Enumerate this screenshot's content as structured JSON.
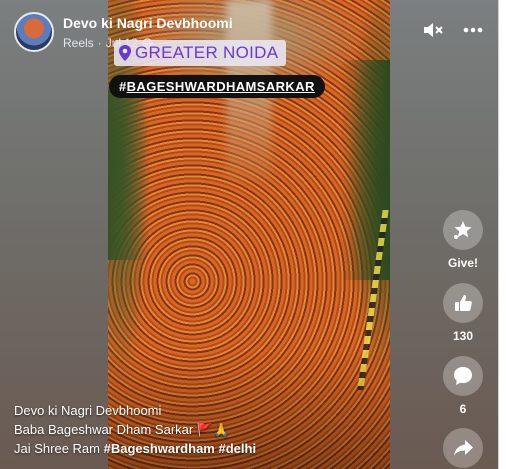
{
  "header": {
    "page_name": "Devo ki Nagri Devbhoomi",
    "meta_type": "Reels",
    "meta_separator": "·",
    "meta_date": "Jul 12",
    "privacy_icon": "globe-icon",
    "mute_icon": "speaker-muted-icon",
    "more_icon": "more-dots-icon"
  },
  "video": {
    "location_icon": "location-pin-icon",
    "location_text": "GREATER NOIDA",
    "hashtag_prefix": "#",
    "hashtag_text": "BAGESHWARDHAMSARKAR"
  },
  "actions": {
    "give_label": "Give!",
    "like_count": "130",
    "comment_count": "6"
  },
  "caption": {
    "line1": "Devo ki Nagri Devbhoomi",
    "line2": "Baba Bageshwar Dham Sarkar",
    "line2_emoji": "🚩🙏",
    "line3_text": "Jai Shree Ram ",
    "tag1": "#Bageshwardham",
    "tag2": "#delhi"
  },
  "colors": {
    "location_text": "#6a3ad0",
    "hashtag_bg": "#111111"
  }
}
